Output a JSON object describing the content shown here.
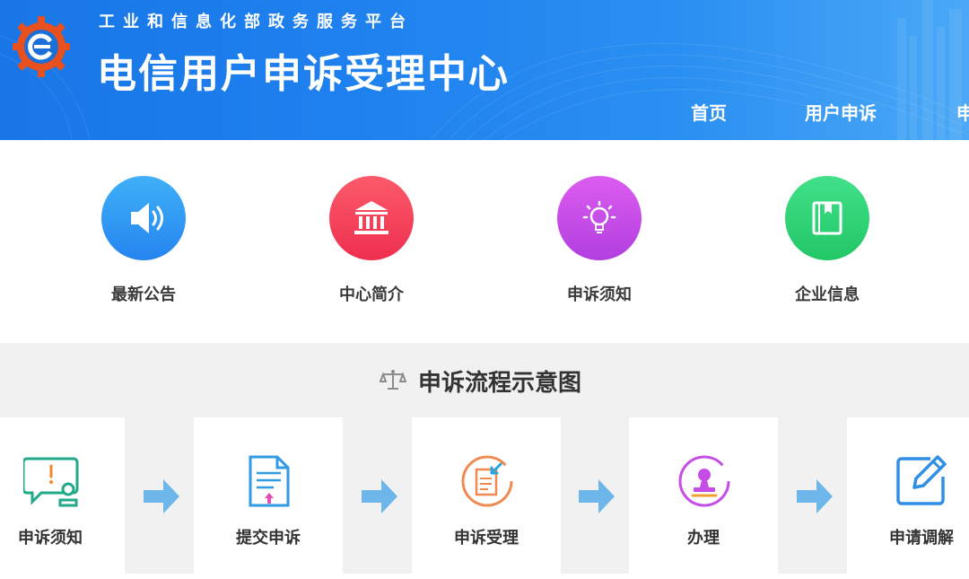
{
  "header": {
    "subtitle": "工业和信息化部政务服务平台",
    "title": "电信用户申诉受理中心",
    "nav": [
      "首页",
      "用户申诉",
      "申"
    ]
  },
  "quick_links": [
    {
      "label": "最新公告",
      "icon": "speaker-icon",
      "color": "#2f93f3"
    },
    {
      "label": "中心简介",
      "icon": "building-icon",
      "color": "#f3415a"
    },
    {
      "label": "申诉须知",
      "icon": "lightbulb-icon",
      "color": "#c64ce8"
    },
    {
      "label": "企业信息",
      "icon": "book-icon",
      "color": "#2fd476"
    }
  ],
  "process": {
    "title": "申诉流程示意图",
    "steps": [
      {
        "label": "申诉须知",
        "icon": "notice-chat-icon"
      },
      {
        "label": "提交申诉",
        "icon": "submit-document-icon"
      },
      {
        "label": "申诉受理",
        "icon": "accept-document-icon"
      },
      {
        "label": "办理",
        "icon": "stamp-icon"
      },
      {
        "label": "申请调解",
        "icon": "edit-icon"
      }
    ]
  },
  "colors": {
    "header_blue": "#1e80ee",
    "arrow_blue": "#6db6ea",
    "process_bg": "#f1f1f1"
  }
}
